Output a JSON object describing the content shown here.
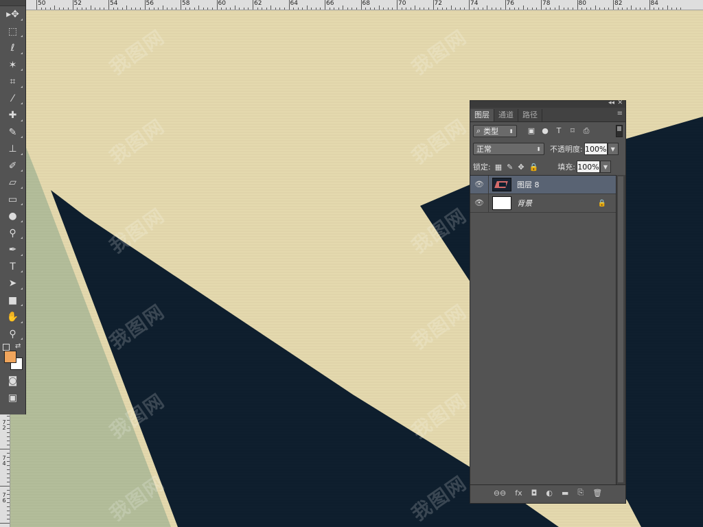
{
  "ruler": {
    "top_labels": [
      "50",
      "52",
      "54",
      "56",
      "58",
      "60",
      "62",
      "64",
      "66",
      "68",
      "70",
      "72",
      "74",
      "76",
      "78",
      "80",
      "82",
      "84"
    ],
    "left_labels": [
      "7",
      "2",
      "7",
      "4",
      "7",
      "6"
    ]
  },
  "watermark": {
    "text": "我图网"
  },
  "toolbar": {
    "tools": [
      {
        "name": "move-tool",
        "icon": "move-icon",
        "glyph": "▸✥"
      },
      {
        "name": "marquee-tool",
        "icon": "rect-marquee-icon",
        "glyph": "⬚"
      },
      {
        "name": "lasso-tool",
        "icon": "lasso-icon",
        "glyph": "ℓ"
      },
      {
        "name": "magic-wand-tool",
        "icon": "magic-wand-icon",
        "glyph": "✶"
      },
      {
        "name": "crop-tool",
        "icon": "crop-icon",
        "glyph": "⌗"
      },
      {
        "name": "eyedropper-tool",
        "icon": "eyedropper-icon",
        "glyph": "⁄"
      },
      {
        "name": "healing-brush-tool",
        "icon": "bandage-icon",
        "glyph": "✚"
      },
      {
        "name": "brush-tool",
        "icon": "brush-icon",
        "glyph": "✎"
      },
      {
        "name": "clone-stamp-tool",
        "icon": "stamp-icon",
        "glyph": "⊥"
      },
      {
        "name": "history-brush-tool",
        "icon": "history-brush-icon",
        "glyph": "✐"
      },
      {
        "name": "eraser-tool",
        "icon": "eraser-icon",
        "glyph": "▱"
      },
      {
        "name": "gradient-tool",
        "icon": "gradient-icon",
        "glyph": "▭"
      },
      {
        "name": "blur-tool",
        "icon": "blur-drop-icon",
        "glyph": "●"
      },
      {
        "name": "dodge-tool",
        "icon": "dodge-icon",
        "glyph": "⚲"
      },
      {
        "name": "pen-tool",
        "icon": "pen-icon",
        "glyph": "✒"
      },
      {
        "name": "type-tool",
        "icon": "type-icon",
        "glyph": "T"
      },
      {
        "name": "path-selection-tool",
        "icon": "arrow-icon",
        "glyph": "➤"
      },
      {
        "name": "rectangle-tool",
        "icon": "rectangle-icon",
        "glyph": "■"
      },
      {
        "name": "hand-tool",
        "icon": "hand-icon",
        "glyph": "✋"
      },
      {
        "name": "zoom-tool",
        "icon": "zoom-icon",
        "glyph": "⚲"
      }
    ],
    "foreground_color": "#f0a55c",
    "background_color": "#ffffff",
    "quick_mask_glyph": "◙",
    "screen_mode_glyph": "▣"
  },
  "panel": {
    "collapse_glyph": "◂◂",
    "close_glyph": "✕",
    "tabs": [
      "图层",
      "通道",
      "路径"
    ],
    "menu_glyph": "≡",
    "filter_label": "类型",
    "filter_icons": [
      "▣",
      "●",
      "T",
      "⌑",
      "⎙"
    ],
    "blend_mode": "正常",
    "opacity_label": "不透明度:",
    "opacity_value": "100%",
    "lock_label": "锁定:",
    "lock_icons": [
      "▦",
      "✎",
      "✥",
      "🔒"
    ],
    "fill_label": "填充:",
    "fill_value": "100%",
    "layers": [
      {
        "name": "图层 8",
        "selected": true,
        "italic": false,
        "locked": false
      },
      {
        "name": "背景",
        "selected": false,
        "italic": true,
        "locked": true
      }
    ],
    "bottom_icons": [
      "⊖⊖",
      "fx",
      "◘",
      "◐",
      "▬",
      "⎘",
      "🗑"
    ]
  },
  "colors": {
    "canvas_beige": "#e4d9ae",
    "navy": "#0f1f2e",
    "sage": "#b3bd9a"
  }
}
